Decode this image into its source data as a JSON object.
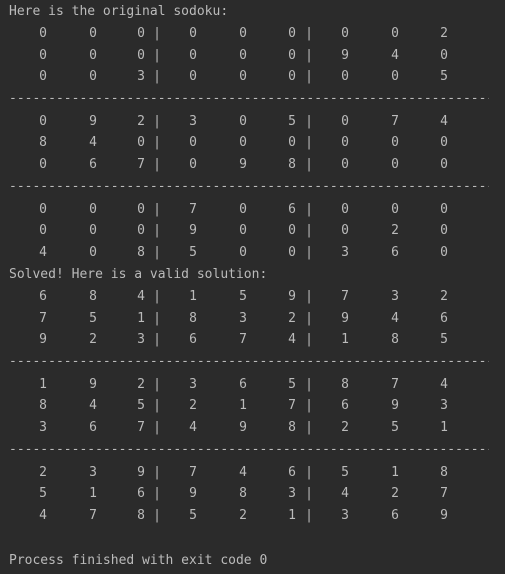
{
  "console": {
    "original_header": "Here is the original sodoku:",
    "original_grid": [
      [
        "0",
        "0",
        "0",
        "0",
        "0",
        "0",
        "0",
        "0",
        "2"
      ],
      [
        "0",
        "0",
        "0",
        "0",
        "0",
        "0",
        "9",
        "4",
        "0"
      ],
      [
        "0",
        "0",
        "3",
        "0",
        "0",
        "0",
        "0",
        "0",
        "5"
      ],
      [
        "0",
        "9",
        "2",
        "3",
        "0",
        "5",
        "0",
        "7",
        "4"
      ],
      [
        "8",
        "4",
        "0",
        "0",
        "0",
        "0",
        "0",
        "0",
        "0"
      ],
      [
        "0",
        "6",
        "7",
        "0",
        "9",
        "8",
        "0",
        "0",
        "0"
      ],
      [
        "0",
        "0",
        "0",
        "7",
        "0",
        "6",
        "0",
        "0",
        "0"
      ],
      [
        "0",
        "0",
        "0",
        "9",
        "0",
        "0",
        "0",
        "2",
        "0"
      ],
      [
        "4",
        "0",
        "8",
        "5",
        "0",
        "0",
        "3",
        "6",
        "0"
      ]
    ],
    "solved_header": "Solved! Here is a valid solution:",
    "solved_grid": [
      [
        "6",
        "8",
        "4",
        "1",
        "5",
        "9",
        "7",
        "3",
        "2"
      ],
      [
        "7",
        "5",
        "1",
        "8",
        "3",
        "2",
        "9",
        "4",
        "6"
      ],
      [
        "9",
        "2",
        "3",
        "6",
        "7",
        "4",
        "1",
        "8",
        "5"
      ],
      [
        "1",
        "9",
        "2",
        "3",
        "6",
        "5",
        "8",
        "7",
        "4"
      ],
      [
        "8",
        "4",
        "5",
        "2",
        "1",
        "7",
        "6",
        "9",
        "3"
      ],
      [
        "3",
        "6",
        "7",
        "4",
        "9",
        "8",
        "2",
        "5",
        "1"
      ],
      [
        "2",
        "3",
        "9",
        "7",
        "4",
        "6",
        "5",
        "1",
        "8"
      ],
      [
        "5",
        "1",
        "6",
        "9",
        "8",
        "3",
        "4",
        "2",
        "7"
      ],
      [
        "4",
        "7",
        "8",
        "5",
        "2",
        "1",
        "3",
        "6",
        "9"
      ]
    ],
    "divider_text": "------------------------------------------------------------------",
    "cell_separator": "|",
    "exit_message": "Process finished with exit code 0"
  }
}
